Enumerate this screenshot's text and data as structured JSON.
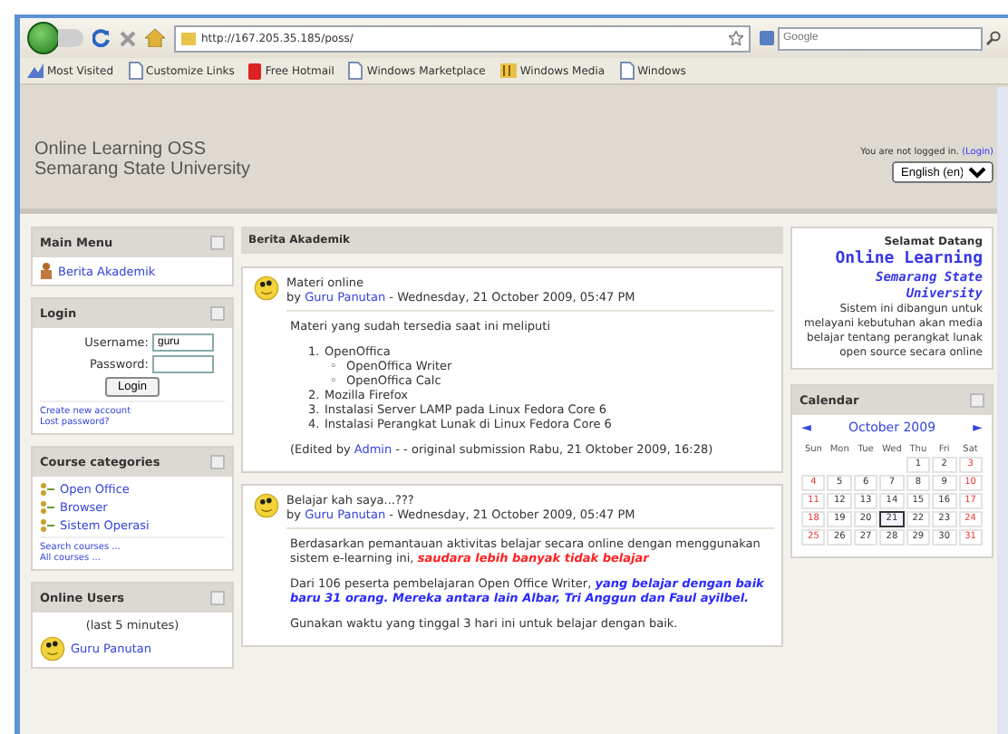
{
  "browser": {
    "url": "http://167.205.35.185/poss/",
    "search": {
      "placeholder": "Google"
    },
    "bookmarks": [
      {
        "label": "Most Visited",
        "kind": "star"
      },
      {
        "label": "Customize Links",
        "kind": "page"
      },
      {
        "label": "Free Hotmail",
        "kind": "mail"
      },
      {
        "label": "Windows Marketplace",
        "kind": "page"
      },
      {
        "label": "Windows Media",
        "kind": "media"
      },
      {
        "label": "Windows",
        "kind": "page"
      }
    ]
  },
  "header": {
    "site_lines": [
      "Online Learning OSS",
      "Semarang State University"
    ],
    "login_info": "You are not logged in.",
    "login_link": "(Login)",
    "language": "English (en)"
  },
  "main_menu": {
    "title": "Main Menu",
    "items": [
      "Berita Akademik"
    ]
  },
  "login": {
    "title": "Login",
    "username_label": "Username:",
    "username": "guru",
    "password_label": "Password:",
    "button": "Login",
    "links": [
      "Create new account",
      "Lost password?"
    ]
  },
  "course_categories": {
    "title": "Course categories",
    "items": [
      "Open Office",
      "Browser",
      "Sistem Operasi"
    ],
    "links": [
      "Search courses ...",
      "All courses ..."
    ]
  },
  "online_users": {
    "title": "Online Users",
    "note": "(last 5 minutes)",
    "users": [
      "Guru Panutan"
    ]
  },
  "news": {
    "title": "Berita Akademik",
    "posts": [
      {
        "subject": "Materi online",
        "by": "by",
        "author": "Guru Panutan",
        "date": " - Wednesday, 21 October 2009, 05:47 PM",
        "blocks": [
          {
            "kind": "text",
            "parts": [
              {
                "text": "Materi yang sudah tersedia saat ini meliputi",
                "kind": "plain"
              }
            ]
          },
          {
            "kind": "list",
            "items": [
              {
                "marker": "1.",
                "text": "OpenOffica",
                "children": [
                  {
                    "marker": "◦",
                    "text": "OpenOffica Writer"
                  },
                  {
                    "marker": "◦",
                    "text": "OpenOffica Calc"
                  }
                ]
              },
              {
                "marker": "2.",
                "text": "Mozilla Firefox"
              },
              {
                "marker": "3.",
                "text": "Instalasi Server LAMP pada Linux Fedora Core 6"
              },
              {
                "marker": "4.",
                "text": "Instalasi Perangkat Lunak di Linux Fedora Core 6"
              }
            ]
          },
          {
            "kind": "edited",
            "parts": [
              {
                "text": "(Edited by ",
                "kind": "plain"
              },
              {
                "text": "Admin",
                "kind": "link"
              },
              {
                "text": " - - original submission Rabu, 21 Oktober 2009, 16:28)",
                "kind": "plain"
              }
            ]
          }
        ]
      },
      {
        "subject": "Belajar kah saya...???",
        "by": "by",
        "author": "Guru Panutan",
        "date": " - Wednesday, 21 October 2009, 05:47 PM",
        "blocks": [
          {
            "kind": "text",
            "parts": [
              {
                "text": "Berdasarkan pemantauan aktivitas belajar secara online dengan menggunakan sistem e-learning ini, ",
                "kind": "plain"
              },
              {
                "text": "saudara lebih banyak tidak belajar",
                "kind": "emphasis",
                "color": "#ff2020"
              }
            ]
          },
          {
            "kind": "text",
            "parts": [
              {
                "text": "Dari 106 peserta pembelajaran Open Office Writer, ",
                "kind": "plain"
              },
              {
                "text": "yang belajar dengan baik baru 31 orang. Mereka antara lain Albar, Tri Anggun dan Faul ayilbel.",
                "kind": "emphasis",
                "color": "#2a2aff"
              }
            ]
          },
          {
            "kind": "text",
            "parts": [
              {
                "text": "Gunakan waktu yang tinggal 3 hari ini untuk belajar dengan baik.",
                "kind": "plain"
              }
            ]
          }
        ]
      }
    ]
  },
  "welcome": {
    "title": "Selamat Datang",
    "heading": "Online Learning",
    "subheading_lines": [
      "Semarang State",
      "University"
    ],
    "text": "Sistem ini dibangun untuk melayani kebutuhan akan media belajar tentang perangkat lunak open source secara online"
  },
  "calendar": {
    "title": "Calendar",
    "prev": "◄",
    "month": "October 2009",
    "next": "►",
    "weekdays": [
      "Sun",
      "Mon",
      "Tue",
      "Wed",
      "Thu",
      "Fri",
      "Sat"
    ],
    "weeks": [
      [
        {
          "d": "1",
          "today": false
        },
        {
          "d": "2",
          "today": false
        },
        {
          "d": "3",
          "today": false
        }
      ],
      [
        {
          "d": "4",
          "today": false
        },
        {
          "d": "5",
          "today": false
        },
        {
          "d": "6",
          "today": false
        },
        {
          "d": "7",
          "today": false
        },
        {
          "d": "8",
          "today": false
        },
        {
          "d": "9",
          "today": false
        },
        {
          "d": "10",
          "today": false
        }
      ],
      [
        {
          "d": "11",
          "today": false
        },
        {
          "d": "12",
          "today": false
        },
        {
          "d": "13",
          "today": false
        },
        {
          "d": "14",
          "today": false
        },
        {
          "d": "15",
          "today": false
        },
        {
          "d": "16",
          "today": false
        },
        {
          "d": "17",
          "today": false
        }
      ],
      [
        {
          "d": "18",
          "today": false
        },
        {
          "d": "19",
          "today": false
        },
        {
          "d": "20",
          "today": false
        },
        {
          "d": "21",
          "today": true
        },
        {
          "d": "22",
          "today": false
        },
        {
          "d": "23",
          "today": false
        },
        {
          "d": "24",
          "today": false
        }
      ],
      [
        {
          "d": "25",
          "today": false
        },
        {
          "d": "26",
          "today": false
        },
        {
          "d": "27",
          "today": false
        },
        {
          "d": "28",
          "today": false
        },
        {
          "d": "29",
          "today": false
        },
        {
          "d": "30",
          "today": false
        },
        {
          "d": "31",
          "today": false
        }
      ]
    ]
  }
}
